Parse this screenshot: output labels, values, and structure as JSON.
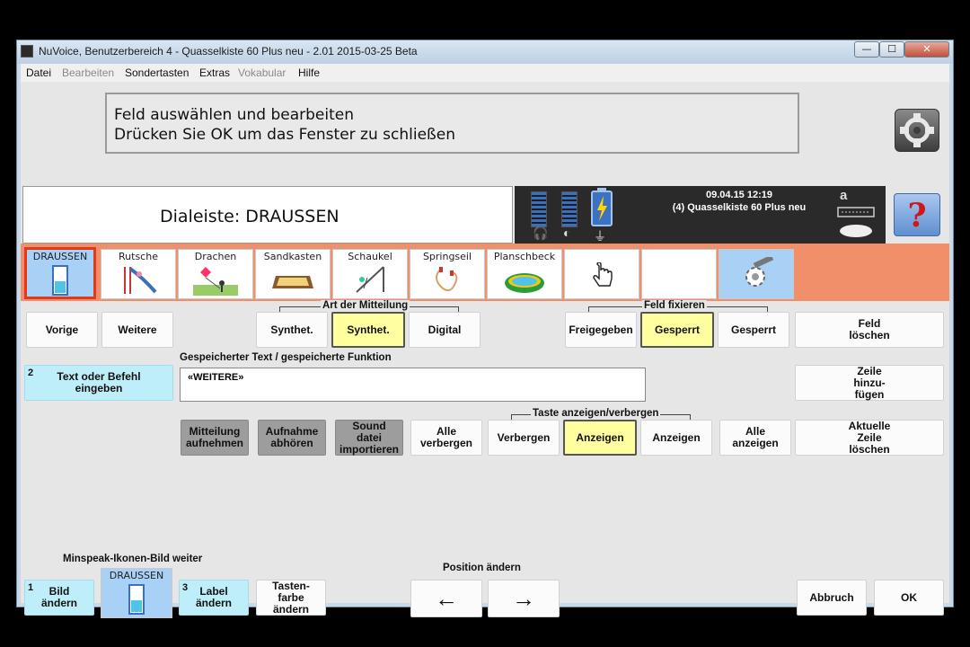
{
  "window": {
    "title": "NuVoice, Benutzerbereich 4 - Quasselkiste 60 Plus neu - 2.01 2015-03-25 Beta",
    "controls": {
      "minimize": "—",
      "maximize": "☐",
      "close": "✕"
    }
  },
  "menu": [
    {
      "label": "Datei",
      "enabled": true
    },
    {
      "label": "Bearbeiten",
      "enabled": false
    },
    {
      "label": "Sondertasten",
      "enabled": true
    },
    {
      "label": "Extras",
      "enabled": true
    },
    {
      "label": "Vokabular",
      "enabled": false
    },
    {
      "label": "Hilfe",
      "enabled": true
    }
  ],
  "instruction": {
    "line1": "Feld auswählen und bearbeiten",
    "line2": "Drücken Sie OK um das Fenster zu schließen"
  },
  "help_button": "?",
  "dialeiste": "Dialeiste: DRAUSSEN",
  "status": {
    "datetime": "09.04.15 12:19",
    "vocabulary": "(4) Quasselkiste 60 Plus neu",
    "language_glyph": "a",
    "icons": [
      "headphones-icon",
      "mic-icon",
      "battery-icon",
      "plug-icon",
      "keyboard-icon",
      "speech-bubble-icon"
    ]
  },
  "icon_row": [
    {
      "label": "DRAUSSEN",
      "icon": "door-icon",
      "glyph": "▯",
      "state": "selected"
    },
    {
      "label": "Rutsche",
      "icon": "slide-icon",
      "glyph": "⛹",
      "state": "normal"
    },
    {
      "label": "Drachen",
      "icon": "kite-icon",
      "glyph": "🪁",
      "state": "normal"
    },
    {
      "label": "Sandkasten",
      "icon": "sandbox-icon",
      "glyph": "▭",
      "state": "normal"
    },
    {
      "label": "Schaukel",
      "icon": "swing-icon",
      "glyph": "⤳",
      "state": "normal"
    },
    {
      "label": "Springseil",
      "icon": "jumprope-icon",
      "glyph": "➰",
      "state": "normal"
    },
    {
      "label": "Planschbeck",
      "icon": "pool-icon",
      "glyph": "◎",
      "state": "normal"
    },
    {
      "label": "",
      "icon": "hand-pointer-icon",
      "glyph": "☝",
      "state": "normal"
    },
    {
      "label": "",
      "icon": "empty-icon",
      "glyph": "",
      "state": "normal"
    },
    {
      "label": "",
      "icon": "tools-icon",
      "glyph": "⚙",
      "state": "blue"
    }
  ],
  "nav": {
    "prev": "Vorige",
    "next": "Weitere"
  },
  "art_der_mitteilung": {
    "label": "Art der Mitteilung",
    "options": [
      "Synthet.",
      "Synthet.",
      "Digital"
    ],
    "selected_index": 1
  },
  "feld_fixieren": {
    "label": "Feld fixieren",
    "options": [
      "Freigegeben",
      "Gesperrt",
      "Gesperrt"
    ],
    "selected_index": 1
  },
  "feld_loeschen": "Feld\nlöschen",
  "text_cmd": {
    "num": "2",
    "label": "Text oder Befehl eingeben"
  },
  "stored_label": "Gespeicherter Text / gespeicherte Funktion",
  "stored_value": "«WEITERE»",
  "zeile_hinzufuegen": "Zeile hinzu-fügen",
  "audio": {
    "record": "Mitteilung aufnehmen",
    "listen": "Aufnahme abhören",
    "import": "Sound datei importieren"
  },
  "taste": {
    "label": "Taste anzeigen/verbergen",
    "hide_all": "Alle verbergen",
    "options": [
      "Verbergen",
      "Anzeigen",
      "Anzeigen"
    ],
    "selected_index": 1,
    "show_all": "Alle anzeigen"
  },
  "aktuelle_zeile_loeschen": "Aktuelle Zeile löschen",
  "bottom": {
    "minspeak_label": "Minspeak-Ikonen-Bild weiter",
    "bild_num": "1",
    "bild": "Bild ändern",
    "preview_label": "DRAUSSEN",
    "label_num": "3",
    "label_btn": "Label ändern",
    "tastenfarbe": "Tasten-farbe ändern",
    "position_label": "Position ändern",
    "left_arrow": "←",
    "right_arrow": "→",
    "cancel": "Abbruch",
    "ok": "OK"
  },
  "colors": {
    "icon_row_bg": "#f08f6a",
    "selected_border": "#e03a1a",
    "highlight_yellow": "#ffffa0",
    "cyan_button": "#bdeefa",
    "status_bg": "#2a2a2a"
  }
}
